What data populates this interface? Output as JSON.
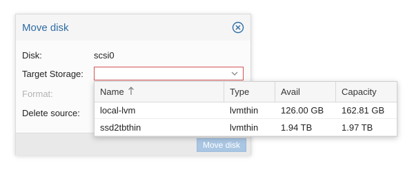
{
  "dialog": {
    "title": "Move disk",
    "close_icon": "close-circle-icon",
    "fields": {
      "disk_label": "Disk:",
      "disk_value": "scsi0",
      "target_label": "Target Storage:",
      "target_value": "",
      "format_label": "Format:",
      "delete_label": "Delete source:"
    },
    "move_button": "Move disk"
  },
  "storage_grid": {
    "columns": [
      "Name",
      "Type",
      "Avail",
      "Capacity"
    ],
    "sort_icon": "sort-ascending-icon",
    "rows": [
      {
        "name": "local-lvm",
        "type": "lvmthin",
        "avail": "126.00 GB",
        "capacity": "162.81 GB"
      },
      {
        "name": "ssd2tbthin",
        "type": "lvmthin",
        "avail": "1.94 TB",
        "capacity": "1.97 TB"
      }
    ]
  },
  "colors": {
    "title": "#2e6ca4",
    "invalid_border": "#d65151",
    "button_disabled": "#a9c6e3"
  }
}
